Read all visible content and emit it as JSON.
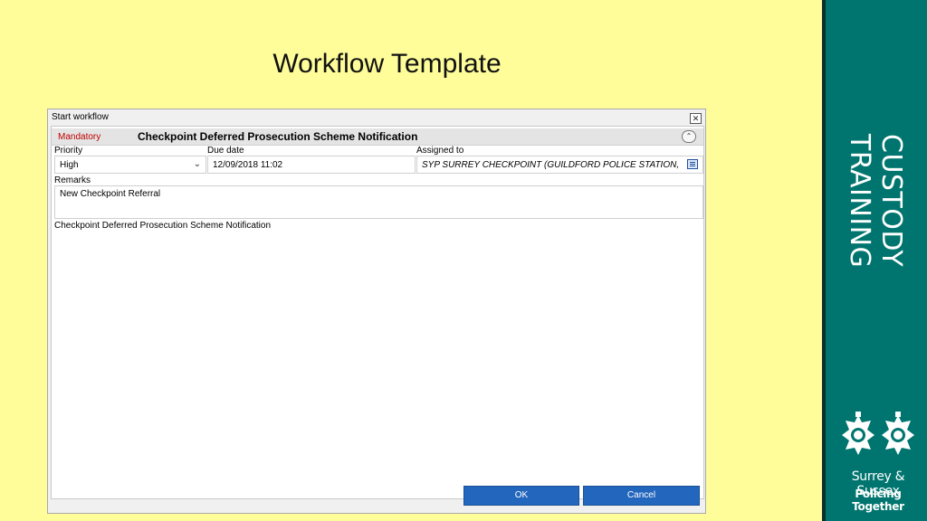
{
  "slide": {
    "title": "Workflow Template",
    "side_text": "CUSTODY TRAINING",
    "brand_line1": "Surrey & Sussex",
    "brand_line2": "Policing Together"
  },
  "window": {
    "title": "Start workflow",
    "close_symbol": "✕",
    "collapse_symbol": "⌃",
    "mandatory_label": "Mandatory",
    "header_title": "Checkpoint Deferred Prosecution Scheme Notification",
    "priority": {
      "label": "Priority",
      "value": "High"
    },
    "due_date": {
      "label": "Due date",
      "value": "12/09/2018 11:02"
    },
    "assigned_to": {
      "label": "Assigned to",
      "value": "SYP SURREY CHECKPOINT (GUILDFORD POLICE STATION,"
    },
    "remarks": {
      "label": "Remarks",
      "value": "New Checkpoint Referral"
    },
    "description": "Checkpoint Deferred Prosecution Scheme Notification",
    "ok_label": "OK",
    "cancel_label": "Cancel"
  },
  "colors": {
    "slide_background": "#FEFD9A",
    "side_panel": "#00756F",
    "button_blue": "#2366BD",
    "mandatory_red": "#C00000"
  }
}
